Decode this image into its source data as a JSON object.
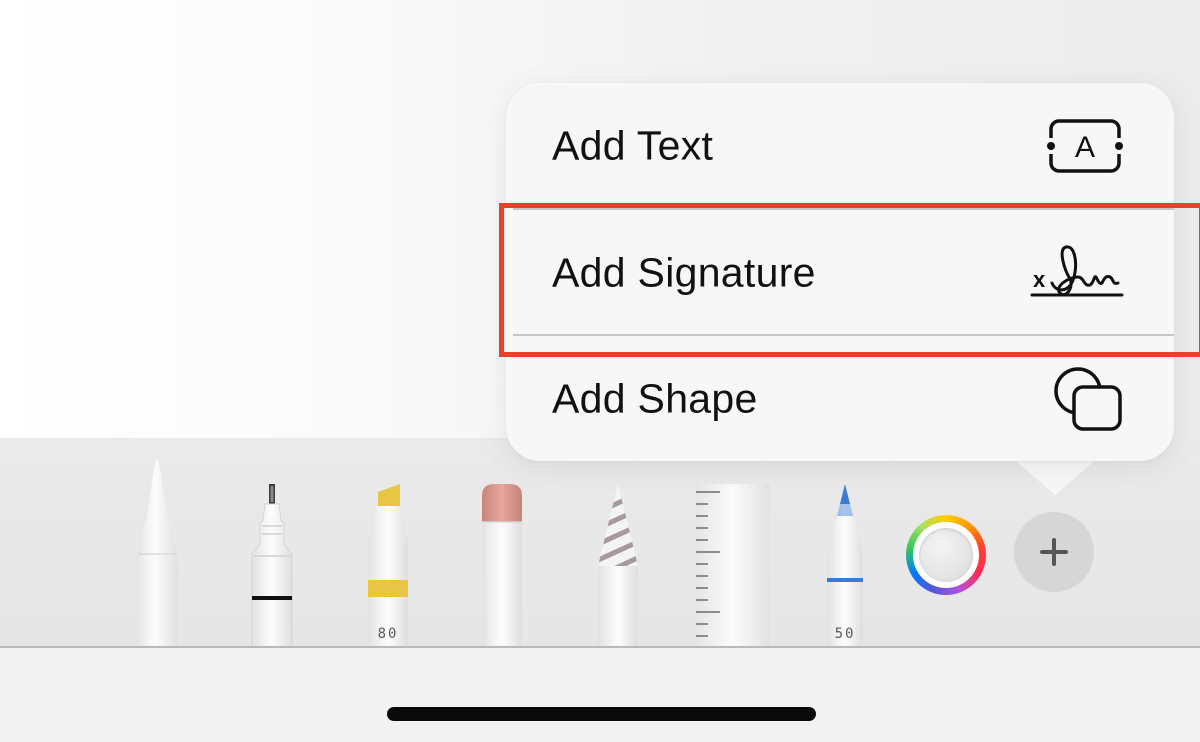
{
  "menu": {
    "items": [
      {
        "label": "Add Text",
        "icon": "text-box-icon"
      },
      {
        "label": "Add Signature",
        "icon": "signature-icon",
        "highlighted": true
      },
      {
        "label": "Add Shape",
        "icon": "shapes-icon"
      }
    ]
  },
  "signature_icon_text": "x",
  "text_box_icon_letter": "A",
  "toolbar": {
    "tools": [
      {
        "name": "pen",
        "icon": "pen-icon"
      },
      {
        "name": "fineliner",
        "icon": "fineliner-icon"
      },
      {
        "name": "highlighter",
        "icon": "highlighter-icon",
        "number": "80",
        "color": "#e8c545"
      },
      {
        "name": "eraser",
        "icon": "eraser-icon"
      },
      {
        "name": "lasso",
        "icon": "lasso-icon"
      },
      {
        "name": "ruler",
        "icon": "ruler-icon"
      },
      {
        "name": "pencil",
        "icon": "pencil-icon",
        "number": "50",
        "color": "#3a7bd5"
      }
    ],
    "color_picker": {
      "icon": "color-wheel-icon"
    },
    "add_button": {
      "icon": "plus-icon"
    }
  },
  "colors": {
    "highlight_border": "#e8402a",
    "popover_bg": "#f7f7f7",
    "toolbar_bg": "#e8e8e8"
  }
}
